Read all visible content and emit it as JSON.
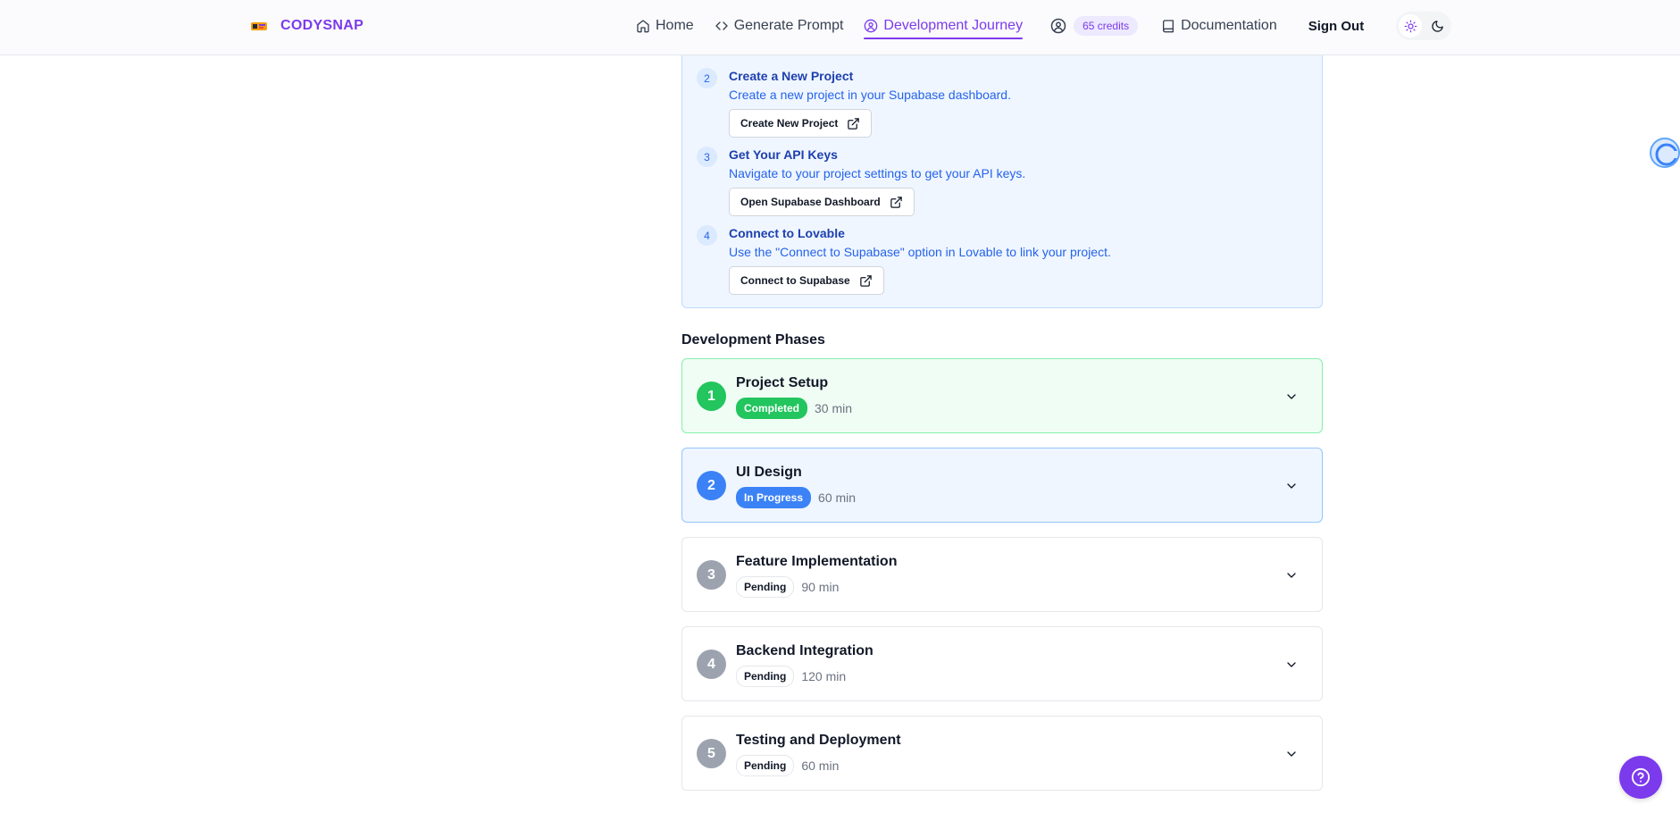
{
  "brand": {
    "name": "CODYSNAP"
  },
  "nav": {
    "home": "Home",
    "generate_prompt": "Generate Prompt",
    "development_journey": "Development Journey",
    "credits": "65 credits",
    "documentation": "Documentation",
    "sign_out": "Sign Out",
    "active": "development_journey"
  },
  "steps": [
    {
      "number": "2",
      "title": "Create a New Project",
      "description": "Create a new project in your Supabase dashboard.",
      "button": "Create New Project"
    },
    {
      "number": "3",
      "title": "Get Your API Keys",
      "description": "Navigate to your project settings to get your API keys.",
      "button": "Open Supabase Dashboard"
    },
    {
      "number": "4",
      "title": "Connect to Lovable",
      "description": "Use the \"Connect to Supabase\" option in Lovable to link your project.",
      "button": "Connect to Supabase"
    }
  ],
  "phases_heading": "Development Phases",
  "phases": [
    {
      "number": "1",
      "title": "Project Setup",
      "status": "Completed",
      "duration": "30 min"
    },
    {
      "number": "2",
      "title": "UI Design",
      "status": "In Progress",
      "duration": "60 min"
    },
    {
      "number": "3",
      "title": "Feature Implementation",
      "status": "Pending",
      "duration": "90 min"
    },
    {
      "number": "4",
      "title": "Backend Integration",
      "status": "Pending",
      "duration": "120 min"
    },
    {
      "number": "5",
      "title": "Testing and Deployment",
      "status": "Pending",
      "duration": "60 min"
    }
  ],
  "colors": {
    "brand": "#7c3aed",
    "completed": "#22c55e",
    "in_progress": "#3b82f6",
    "pending": "#9ca3af"
  },
  "icons": {
    "home": "home-icon",
    "generate": "code-icon",
    "journey": "journey-icon",
    "user": "user-circle-icon",
    "docs": "book-icon",
    "light": "sun-icon",
    "dark": "moon-icon",
    "external": "external-link-icon",
    "expand": "chevron-down-icon",
    "help": "help-circle-icon"
  }
}
